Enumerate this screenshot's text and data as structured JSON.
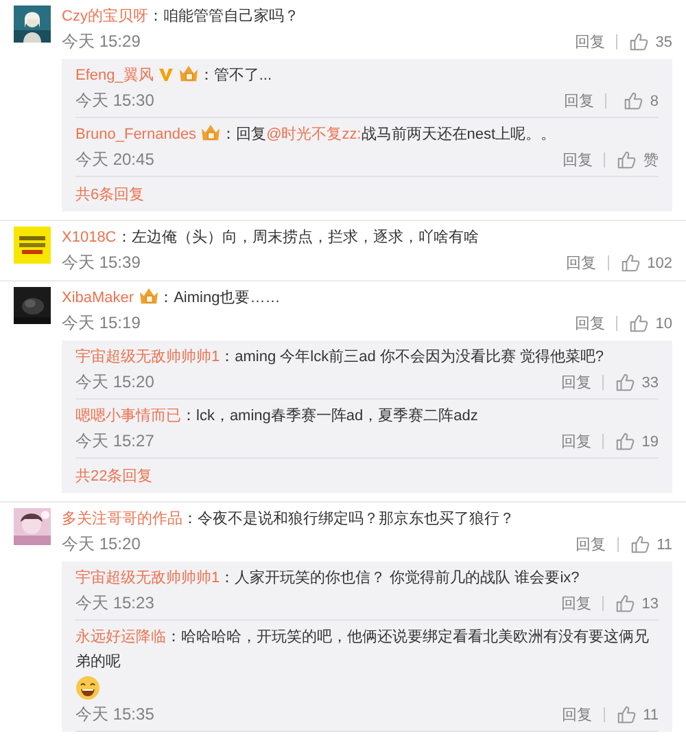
{
  "comments": [
    {
      "avatar": {
        "kind": "picture"
      },
      "user": "Czy的宝贝呀",
      "segments": [
        {
          "kind": "text",
          "text": "：咱能管管自己家吗？"
        }
      ],
      "time": "今天 15:29",
      "reply": "回复",
      "likes": "35",
      "replies": [
        {
          "user": "Efeng_翼风",
          "verified": true,
          "member": true,
          "segments": [
            {
              "kind": "text",
              "text": "：管不了..."
            }
          ],
          "time": "今天 15:30",
          "reply": "回复",
          "likes": "8"
        },
        {
          "user": "Bruno_Fernandes",
          "member": true,
          "segments": [
            {
              "kind": "text",
              "text": "：回复"
            },
            {
              "kind": "mention",
              "text": "@时光不复zz:"
            },
            {
              "kind": "text",
              "text": "战马前两天还在nest上呢。。"
            }
          ],
          "time": "今天 20:45",
          "reply": "回复",
          "likes": "赞"
        }
      ],
      "more": "共6条回复"
    },
    {
      "avatar": {
        "kind": "picture"
      },
      "user": "X1018C",
      "segments": [
        {
          "kind": "text",
          "text": "：左边俺（头）向，周末捞点，拦求，逐求，吖啥有啥"
        }
      ],
      "time": "今天 15:39",
      "reply": "回复",
      "likes": "102"
    },
    {
      "avatar": {
        "kind": "picture"
      },
      "user": "XibaMaker",
      "member": true,
      "segments": [
        {
          "kind": "text",
          "text": "：Aiming也要……"
        }
      ],
      "time": "今天 15:19",
      "reply": "回复",
      "likes": "10",
      "replies": [
        {
          "user": "宇宙超级无敌帅帅帅1",
          "segments": [
            {
              "kind": "text",
              "text": "：aming 今年lck前三ad 你不会因为没看比赛 觉得他菜吧?"
            }
          ],
          "time": "今天 15:20",
          "reply": "回复",
          "likes": "33"
        },
        {
          "user": "嗯嗯小事情而已",
          "segments": [
            {
              "kind": "text",
              "text": "：lck，aming春季赛一阵ad，夏季赛二阵adz"
            }
          ],
          "time": "今天 15:27",
          "reply": "回复",
          "likes": "19"
        }
      ],
      "more": "共22条回复"
    },
    {
      "avatar": {
        "kind": "picture"
      },
      "user": "多关注哥哥的作品",
      "segments": [
        {
          "kind": "text",
          "text": "：令夜不是说和狼行绑定吗？那京东也买了狼行？"
        }
      ],
      "time": "今天 15:20",
      "reply": "回复",
      "likes": "11",
      "replies": [
        {
          "user": "宇宙超级无敌帅帅帅1",
          "segments": [
            {
              "kind": "text",
              "text": "：人家开玩笑的你也信？ 你觉得前几的战队 谁会要ix?"
            }
          ],
          "time": "今天 15:23",
          "reply": "回复",
          "likes": "13"
        },
        {
          "user": "永远好运降临",
          "segments": [
            {
              "kind": "text",
              "text": "：哈哈哈哈，开玩笑的吧，他俩还说要绑定看看北美欧洲有没有要这俩兄弟的呢"
            }
          ],
          "laughing_emoji": true,
          "time": "今天 15:35",
          "reply": "回复",
          "likes": "11"
        }
      ]
    }
  ]
}
